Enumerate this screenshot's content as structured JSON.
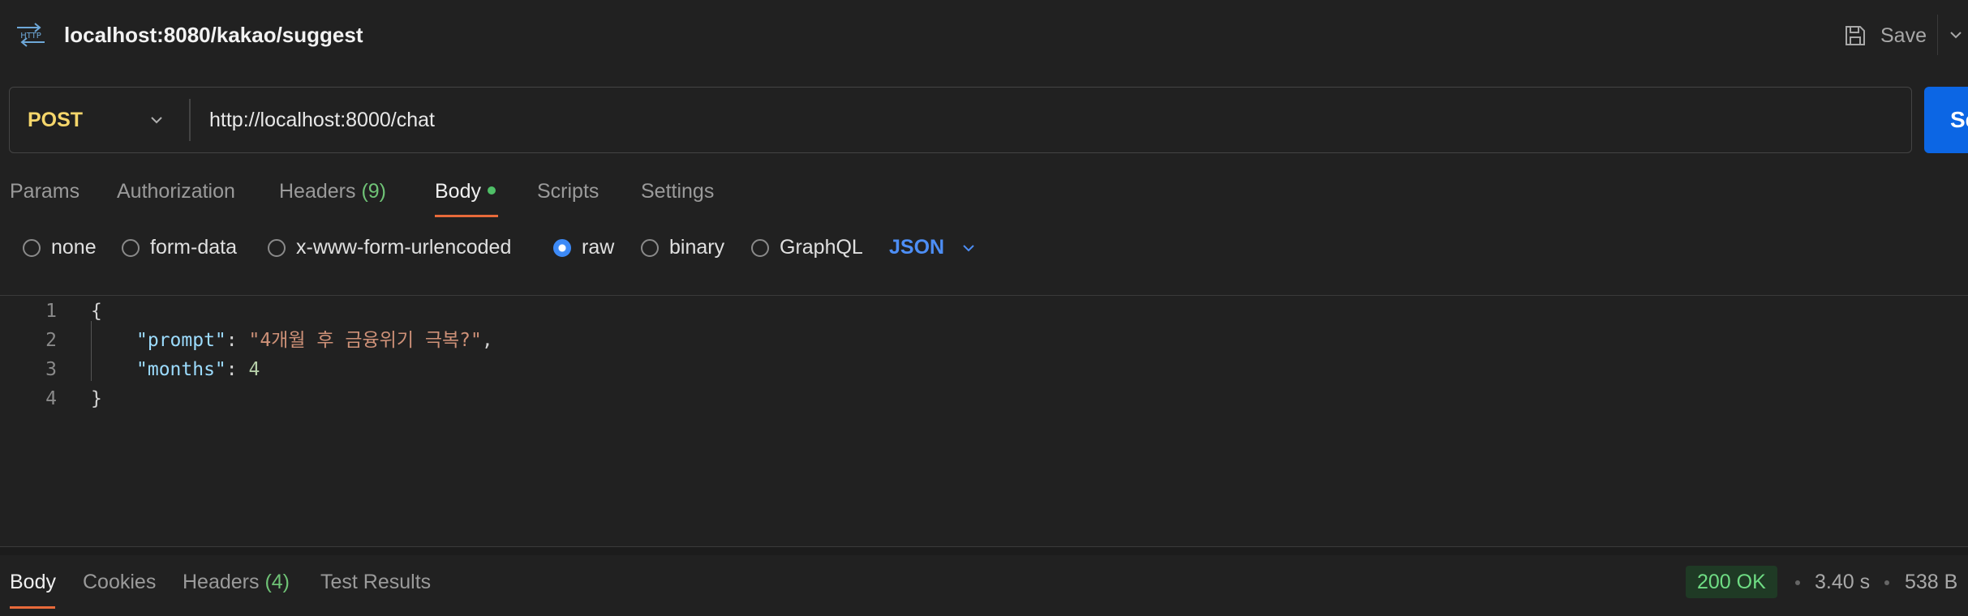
{
  "header": {
    "title": "localhost:8080/kakao/suggest",
    "save_label": "Save",
    "http_icon_text": "HTTP"
  },
  "request": {
    "method": "POST",
    "url": "http://localhost:8000/chat",
    "send_label": "Send"
  },
  "tabs": {
    "params": "Params",
    "authorization": "Authorization",
    "headers": "Headers",
    "headers_count": "(9)",
    "body": "Body",
    "scripts": "Scripts",
    "settings": "Settings"
  },
  "body_types": {
    "none": "none",
    "form_data": "form-data",
    "urlencoded": "x-www-form-urlencoded",
    "raw": "raw",
    "binary": "binary",
    "graphql": "GraphQL",
    "selected": "raw",
    "format": "JSON"
  },
  "editor": {
    "line_numbers": [
      "1",
      "2",
      "3",
      "4"
    ],
    "open_brace": "{",
    "close_brace": "}",
    "key1": "\"prompt\"",
    "val1": "\"4개월 후 금융위기 극복?\"",
    "key2": "\"months\"",
    "val2": "4"
  },
  "response": {
    "tabs": {
      "body": "Body",
      "cookies": "Cookies",
      "headers": "Headers",
      "headers_count": "(4)",
      "test_results": "Test Results"
    },
    "status": "200 OK",
    "time": "3.40 s",
    "size": "538 B"
  },
  "colors": {
    "background": "#212121",
    "method_post": "#f5d66b",
    "accent_blue": "#0c66e4",
    "active_tab_underline": "#e86a3a",
    "status_ok": "#6fdc84"
  }
}
